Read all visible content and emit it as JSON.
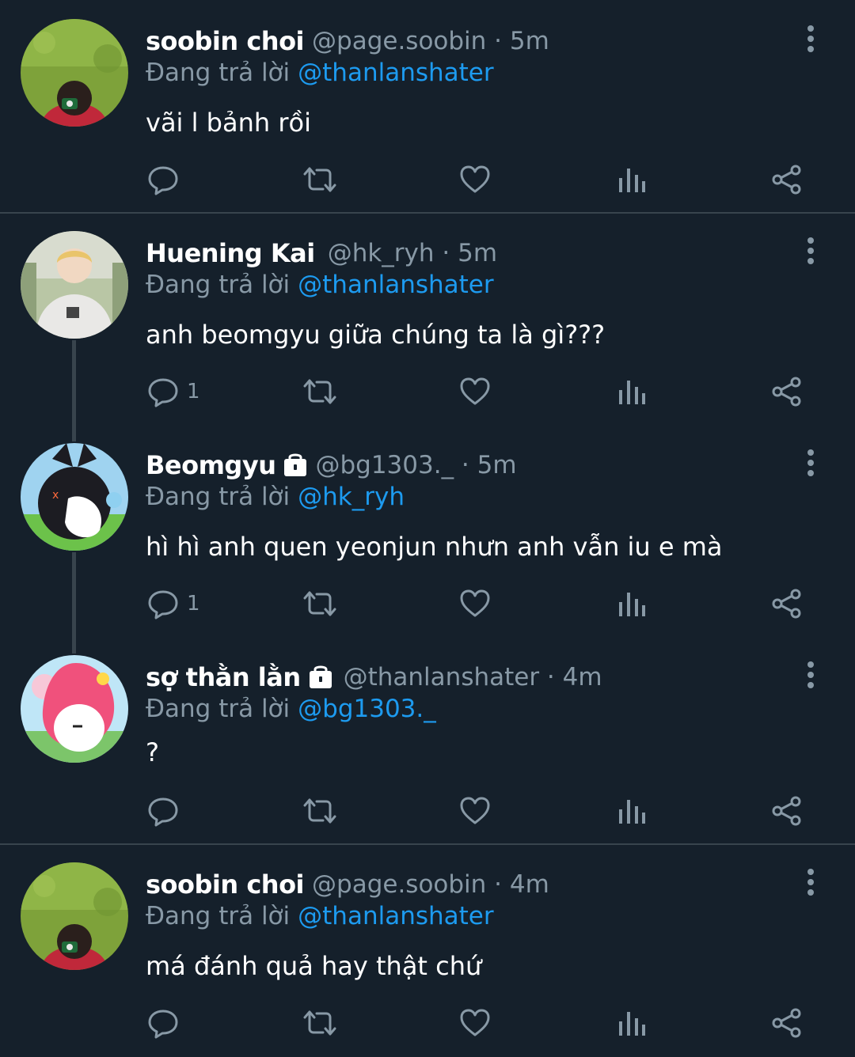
{
  "colors": {
    "background": "#15202b",
    "muted": "#8899a6",
    "link": "#1d9bf0",
    "divider": "#38444d"
  },
  "tweets": [
    {
      "name": "soobin choi",
      "handle": "@page.soobin · 5m",
      "reply_prefix": "Đang trả lời",
      "reply_to": "@thanlanshater",
      "text": "vãi l bảnh rồi",
      "reply_count": "",
      "locked": false,
      "avatar": "green-field-photo"
    },
    {
      "name": "Huening Kai",
      "handle": "@hk_ryh · 5m",
      "reply_prefix": "Đang trả lời",
      "reply_to": "@thanlanshater",
      "text": "anh beomgyu giữa chúng ta là gì???",
      "reply_count": "1",
      "locked": false,
      "avatar": "blonde-person-photo"
    },
    {
      "name": "Beomgyu",
      "handle": "@bg1303._ · 5m",
      "reply_prefix": "Đang trả lời",
      "reply_to": "@hk_ryh",
      "text": "hì hì anh quen yeonjun nhưn anh vẫn iu e mà",
      "reply_count": "1",
      "locked": true,
      "avatar": "kuromi-cartoon"
    },
    {
      "name": "sợ thằn lằn",
      "handle": "@thanlanshater · 4m",
      "reply_prefix": "Đang trả lời",
      "reply_to": "@bg1303._",
      "text": "?",
      "reply_count": "",
      "locked": true,
      "avatar": "my-melody-cartoon"
    },
    {
      "name": "soobin choi",
      "handle": "@page.soobin · 4m",
      "reply_prefix": "Đang trả lời",
      "reply_to": "@thanlanshater",
      "text": "má đánh quả hay thật chứ",
      "reply_count": "",
      "locked": false,
      "avatar": "green-field-photo"
    }
  ],
  "icons": [
    "reply-icon",
    "retweet-icon",
    "like-icon",
    "analytics-icon",
    "share-icon",
    "more-icon",
    "lock-icon"
  ]
}
